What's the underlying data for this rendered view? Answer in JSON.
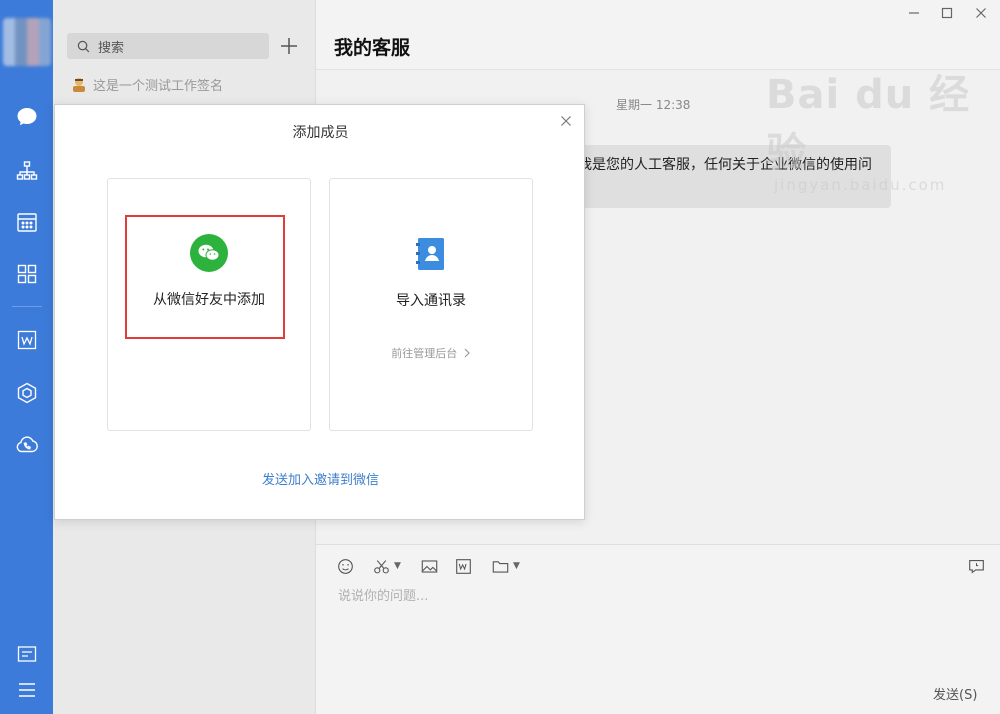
{
  "nav": {
    "items": [
      "chat-icon",
      "org-icon",
      "calendar-icon",
      "apps-icon",
      "doc-icon",
      "workbench-icon",
      "cloud-phone-icon",
      "notes-icon",
      "menu-icon"
    ],
    "accent": "#3c7bd9"
  },
  "sidebar": {
    "search_placeholder": "搜索",
    "signature": "这是一个测试工作签名"
  },
  "chat": {
    "title": "我的客服",
    "timestamp": "星期一 12:38",
    "message": "我是您的人工客服，任何关于企业微信的使用问",
    "input_placeholder": "说说你的问题...",
    "send_label": "发送(S)"
  },
  "watermark": {
    "brand": "Bai du 经验",
    "url": "jingyan.baidu.com"
  },
  "modal": {
    "title": "添加成员",
    "option_wechat_label": "从微信好友中添加",
    "option_contacts_label": "导入通讯录",
    "admin_link": "前往管理后台",
    "invite_link": "发送加入邀请到微信",
    "highlight_color": "#e03c3c",
    "wechat_green": "#2db33d",
    "link_color": "#3d7fcc"
  }
}
